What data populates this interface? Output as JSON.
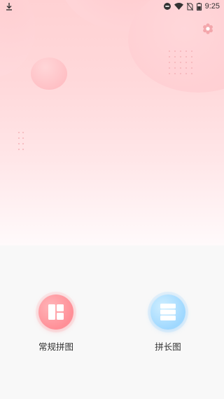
{
  "status_bar": {
    "time": "9:25",
    "icons": [
      "download-icon",
      "do-not-disturb-icon",
      "wifi-icon",
      "no-sim-icon",
      "battery-icon"
    ]
  },
  "header": {
    "settings_icon": "flower-settings-icon",
    "accent_color": "#f3a6ab"
  },
  "actions": [
    {
      "id": "regular",
      "label": "常规拼图",
      "icon": "grid-collage-icon",
      "color": "#ff8f97"
    },
    {
      "id": "long",
      "label": "拼长图",
      "icon": "stacked-long-image-icon",
      "color": "#9fd8ff"
    }
  ]
}
